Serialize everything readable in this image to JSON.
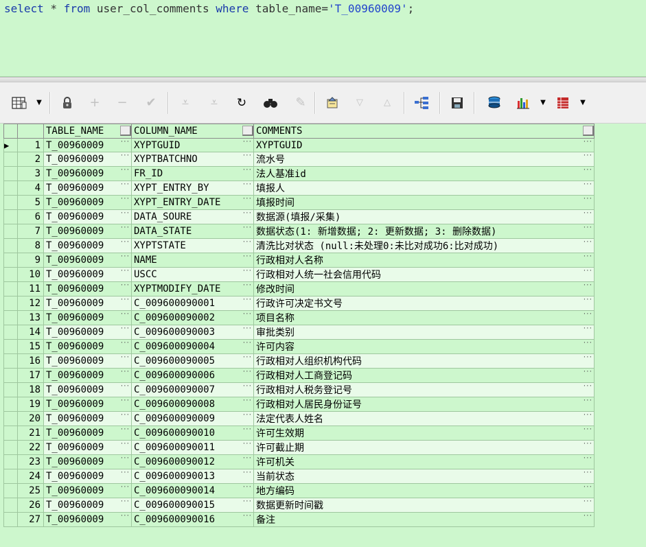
{
  "sql": {
    "kw_select": "select",
    "star": " * ",
    "kw_from": "from",
    "table": " user_col_comments ",
    "kw_where": "where",
    "cond": " table_name=",
    "literal": "'T_00960009'",
    "end": ";"
  },
  "toolbar": {
    "icons": [
      "grid-view-icon",
      "dropdown-arrow-icon",
      "lock-icon",
      "add-record-icon",
      "delete-record-icon",
      "post-changes-icon",
      "query-by-example-icon",
      "clear-qbe-icon",
      "refresh-icon",
      "find-icon",
      "clear-icon",
      "export-icon",
      "next-icon",
      "previous-icon",
      "explain-plan-icon",
      "save-icon",
      "query-icon",
      "chart-icon",
      "dropdown-arrow-icon",
      "single-record-view-icon",
      "dropdown-arrow-icon"
    ]
  },
  "grid": {
    "headers": [
      "TABLE_NAME",
      "COLUMN_NAME",
      "COMMENTS"
    ],
    "rows": [
      {
        "n": "1",
        "t": "T_00960009",
        "c": "XYPTGUID",
        "m": "XYPTGUID"
      },
      {
        "n": "2",
        "t": "T_00960009",
        "c": "XYPTBATCHNO",
        "m": "流水号"
      },
      {
        "n": "3",
        "t": "T_00960009",
        "c": "FR_ID",
        "m": "法人基准id"
      },
      {
        "n": "4",
        "t": "T_00960009",
        "c": "XYPT_ENTRY_BY",
        "m": "填报人"
      },
      {
        "n": "5",
        "t": "T_00960009",
        "c": "XYPT_ENTRY_DATE",
        "m": "填报时间"
      },
      {
        "n": "6",
        "t": "T_00960009",
        "c": "DATA_SOURE",
        "m": "数据源(填报/采集)"
      },
      {
        "n": "7",
        "t": "T_00960009",
        "c": "DATA_STATE",
        "m": "数据状态(1: 新增数据; 2: 更新数据; 3: 删除数据)"
      },
      {
        "n": "8",
        "t": "T_00960009",
        "c": "XYPTSTATE",
        "m": "清洗比对状态 (null:未处理0:未比对成功6:比对成功)"
      },
      {
        "n": "9",
        "t": "T_00960009",
        "c": "NAME",
        "m": "行政相对人名称"
      },
      {
        "n": "10",
        "t": "T_00960009",
        "c": "USCC",
        "m": "行政相对人统一社会信用代码"
      },
      {
        "n": "11",
        "t": "T_00960009",
        "c": "XYPTMODIFY_DATE",
        "m": "修改时间"
      },
      {
        "n": "12",
        "t": "T_00960009",
        "c": "C_009600090001",
        "m": "行政许可决定书文号"
      },
      {
        "n": "13",
        "t": "T_00960009",
        "c": "C_009600090002",
        "m": "项目名称"
      },
      {
        "n": "14",
        "t": "T_00960009",
        "c": "C_009600090003",
        "m": "审批类别"
      },
      {
        "n": "15",
        "t": "T_00960009",
        "c": "C_009600090004",
        "m": "许可内容"
      },
      {
        "n": "16",
        "t": "T_00960009",
        "c": "C_009600090005",
        "m": "行政相对人组织机构代码"
      },
      {
        "n": "17",
        "t": "T_00960009",
        "c": "C_009600090006",
        "m": "行政相对人工商登记码"
      },
      {
        "n": "18",
        "t": "T_00960009",
        "c": "C_009600090007",
        "m": "行政相对人税务登记号"
      },
      {
        "n": "19",
        "t": "T_00960009",
        "c": "C_009600090008",
        "m": "行政相对人居民身份证号"
      },
      {
        "n": "20",
        "t": "T_00960009",
        "c": "C_009600090009",
        "m": "法定代表人姓名"
      },
      {
        "n": "21",
        "t": "T_00960009",
        "c": "C_009600090010",
        "m": "许可生效期"
      },
      {
        "n": "22",
        "t": "T_00960009",
        "c": "C_009600090011",
        "m": "许可截止期"
      },
      {
        "n": "23",
        "t": "T_00960009",
        "c": "C_009600090012",
        "m": "许可机关"
      },
      {
        "n": "24",
        "t": "T_00960009",
        "c": "C_009600090013",
        "m": "当前状态"
      },
      {
        "n": "25",
        "t": "T_00960009",
        "c": "C_009600090014",
        "m": "地方编码"
      },
      {
        "n": "26",
        "t": "T_00960009",
        "c": "C_009600090015",
        "m": "数据更新时间戳"
      },
      {
        "n": "27",
        "t": "T_00960009",
        "c": "C_009600090016",
        "m": "备注"
      }
    ],
    "ellipsis": "···",
    "current_row_marker": "▶"
  }
}
